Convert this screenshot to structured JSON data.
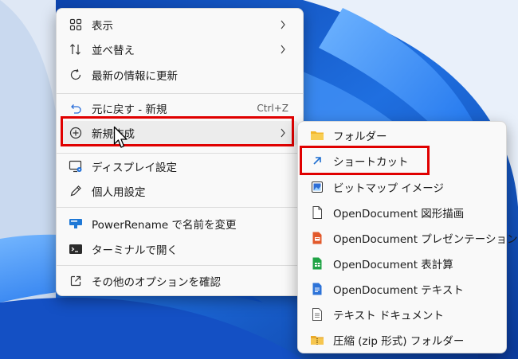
{
  "main_menu": {
    "items": [
      {
        "id": "view",
        "label": "表示",
        "icon": "grid-icon",
        "submenu": true
      },
      {
        "id": "sort",
        "label": "並べ替え",
        "icon": "sort-arrows-icon",
        "submenu": true
      },
      {
        "id": "refresh",
        "label": "最新の情報に更新",
        "icon": "refresh-icon"
      },
      {
        "id": "undo",
        "label": "元に戻す - 新規",
        "icon": "undo-icon",
        "shortcut": "Ctrl+Z"
      },
      {
        "id": "new",
        "label": "新規作成",
        "icon": "plus-circle-icon",
        "submenu": true
      },
      {
        "id": "display",
        "label": "ディスプレイ設定",
        "icon": "display-settings-icon"
      },
      {
        "id": "personalize",
        "label": "個人用設定",
        "icon": "pen-icon"
      },
      {
        "id": "powerrename",
        "label": "PowerRename で名前を変更",
        "icon": "powerrename-icon"
      },
      {
        "id": "terminal",
        "label": "ターミナルで開く",
        "icon": "terminal-icon"
      },
      {
        "id": "more",
        "label": "その他のオプションを確認",
        "icon": "open-external-icon"
      }
    ]
  },
  "sub_menu": {
    "items": [
      {
        "id": "folder",
        "label": "フォルダー",
        "icon": "folder-icon"
      },
      {
        "id": "shortcut",
        "label": "ショートカット",
        "icon": "shortcut-arrow-icon"
      },
      {
        "id": "bitmap",
        "label": "ビットマップ イメージ",
        "icon": "bitmap-icon"
      },
      {
        "id": "odg",
        "label": "OpenDocument 図形描画",
        "icon": "document-icon"
      },
      {
        "id": "odp",
        "label": "OpenDocument プレゼンテーション",
        "icon": "presentation-icon"
      },
      {
        "id": "ods",
        "label": "OpenDocument 表計算",
        "icon": "spreadsheet-icon"
      },
      {
        "id": "odt",
        "label": "OpenDocument テキスト",
        "icon": "text-document-icon"
      },
      {
        "id": "txt",
        "label": "テキスト ドキュメント",
        "icon": "text-file-icon"
      },
      {
        "id": "zip",
        "label": "圧縮 (zip 形式) フォルダー",
        "icon": "zip-folder-icon"
      }
    ]
  },
  "colors": {
    "highlight": "#e00000",
    "accent": "#0067c0",
    "menu_bg": "#f9f9f9"
  }
}
